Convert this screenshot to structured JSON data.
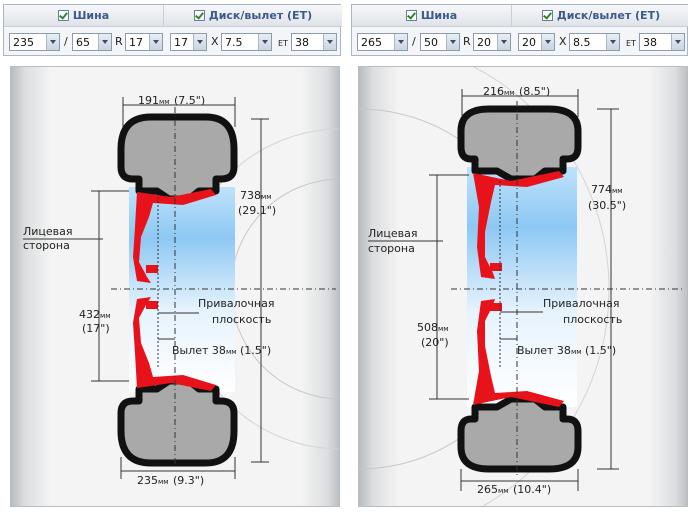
{
  "left": {
    "tire_header": "Шина",
    "disk_header": "Диск/вылет (ET)",
    "width": "235",
    "sep1": "/",
    "profile": "65",
    "sep2": "R",
    "diameter": "17",
    "rim_diameter": "17",
    "sepx": "X",
    "rim_width": "7.5",
    "et_label": "ET",
    "et": "38",
    "dims": {
      "top_mm": "191",
      "top_in": "(7.5\")",
      "outer_mm": "738",
      "outer_in": "(29.1\")",
      "inner_mm": "432",
      "inner_in": "(17\")",
      "bottom_mm": "235",
      "bottom_in": "(9.3\")",
      "mm_unit": "мм",
      "face1": "Лицевая",
      "face2": "сторона",
      "mount1": "Привалочная",
      "mount2": "плоскость",
      "offset_text": "Вылет 38",
      "offset_in": "(1.5\")"
    }
  },
  "right": {
    "tire_header": "Шина",
    "disk_header": "Диск/вылет (ET)",
    "width": "265",
    "sep1": "/",
    "profile": "50",
    "sep2": "R",
    "diameter": "20",
    "rim_diameter": "20",
    "sepx": "X",
    "rim_width": "8.5",
    "et_label": "ET",
    "et": "38",
    "dims": {
      "top_mm": "216",
      "top_in": "(8.5\")",
      "outer_mm": "774",
      "outer_in": "(30.5\")",
      "inner_mm": "508",
      "inner_in": "(20\")",
      "bottom_mm": "265",
      "bottom_in": "(10.4\")",
      "mm_unit": "мм",
      "face1": "Лицевая",
      "face2": "сторона",
      "mount1": "Привалочная",
      "mount2": "плоскость",
      "offset_text": "Вылет 38",
      "offset_in": "(1.5\")"
    }
  },
  "colors": {
    "rim_red": "#e8121a",
    "blue_top": "#9fd0f5",
    "tire_gray": "#a8a8a8",
    "header_text": "#3b5b8c"
  }
}
